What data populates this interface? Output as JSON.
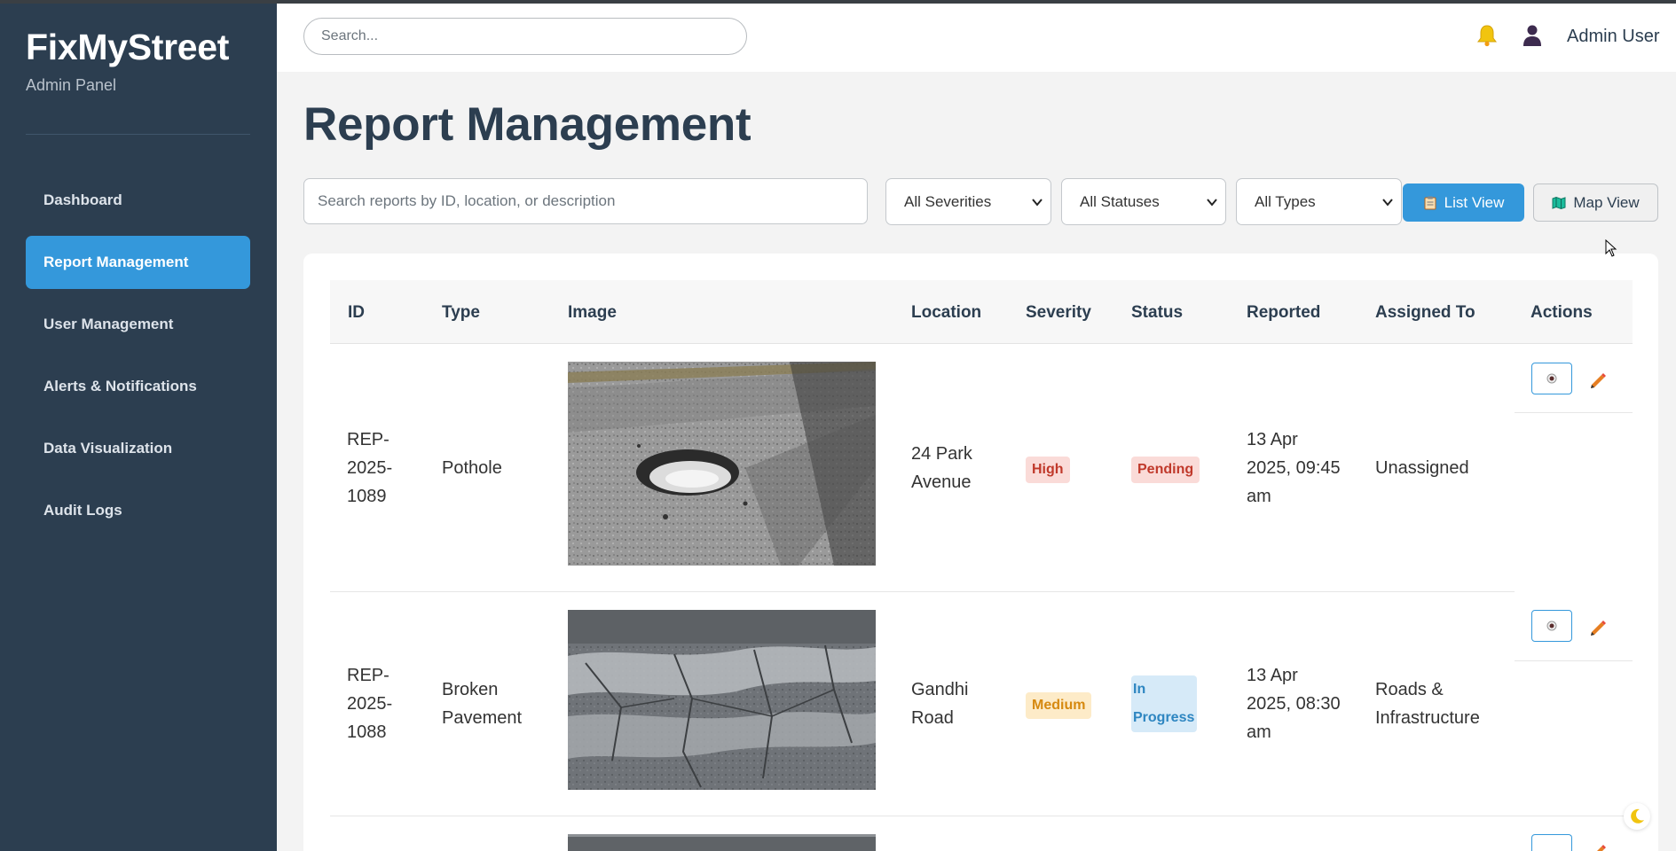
{
  "sidebar": {
    "brand": "FixMyStreet",
    "subtitle": "Admin Panel",
    "items": [
      {
        "label": "Dashboard",
        "active": false
      },
      {
        "label": "Report Management",
        "active": true
      },
      {
        "label": "User Management",
        "active": false
      },
      {
        "label": "Alerts & Notifications",
        "active": false
      },
      {
        "label": "Data Visualization",
        "active": false
      },
      {
        "label": "Audit Logs",
        "active": false
      }
    ]
  },
  "header": {
    "search_placeholder": "Search...",
    "bell_icon": "bell-icon",
    "user_icon": "user-icon",
    "user_name": "Admin User"
  },
  "main": {
    "title": "Report Management",
    "filter_placeholder": "Search reports by ID, location, or description",
    "severity_select": "All Severities",
    "status_select": "All Statuses",
    "type_select": "All Types",
    "list_view_label": "List View",
    "map_view_label": "Map View"
  },
  "table": {
    "columns": [
      "ID",
      "Type",
      "Image",
      "Location",
      "Severity",
      "Status",
      "Reported",
      "Assigned To",
      "Actions"
    ],
    "rows": [
      {
        "id": "REP-2025-1089",
        "type": "Pothole",
        "location": "24 Park Avenue",
        "severity": "High",
        "status": "Pending",
        "reported": "13 Apr 2025, 09:45 am",
        "assigned": "Unassigned"
      },
      {
        "id": "REP-2025-1088",
        "type": "Broken Pavement",
        "location": "Gandhi Road",
        "severity": "Medium",
        "status": "In Progress",
        "reported": "13 Apr 2025, 08:30 am",
        "assigned": "Roads & Infrastructure"
      }
    ]
  },
  "colors": {
    "sidebar_bg": "#2c3e50",
    "accent": "#3498db",
    "high": "#c0392b",
    "medium": "#d68910"
  }
}
